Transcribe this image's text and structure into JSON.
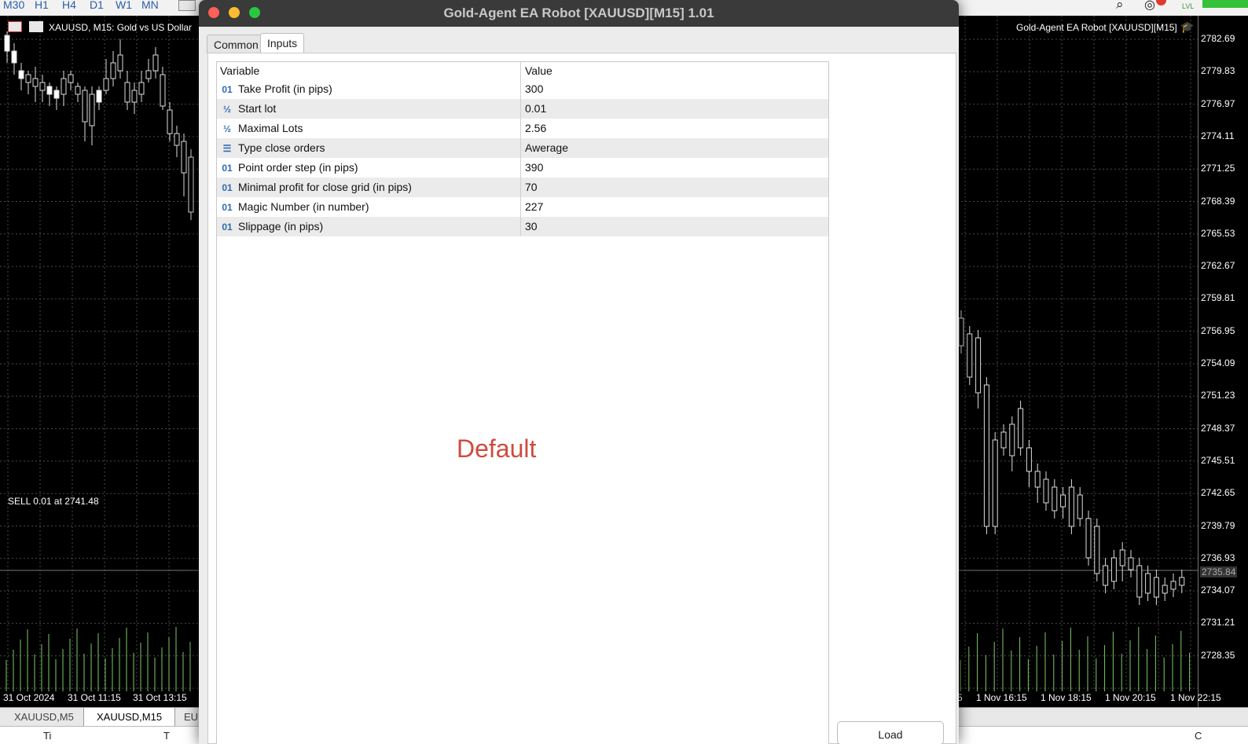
{
  "toolbar": {
    "timeframes": [
      "M30",
      "H1",
      "H4",
      "D1",
      "W1",
      "MN"
    ],
    "level_badge": "LVL"
  },
  "chart_left": {
    "title": "XAUUSD, M15:  Gold vs US Dollar",
    "trade_label": "SELL 0.01 at 2741.48",
    "time_labels": [
      "31 Oct 2024",
      "31 Oct 11:15",
      "31 Oct 13:15"
    ]
  },
  "chart_right": {
    "title": "Gold-Agent EA Robot [XAUUSD][M15]",
    "price_labels": [
      "2782.69",
      "2779.83",
      "2776.97",
      "2774.11",
      "2771.25",
      "2768.39",
      "2765.53",
      "2762.67",
      "2759.81",
      "2756.95",
      "2754.09",
      "2751.23",
      "2748.37",
      "2745.51",
      "2742.65",
      "2739.79",
      "2736.93",
      "2734.07",
      "2731.21",
      "2728.35"
    ],
    "current_price": "2735.84",
    "time_labels": [
      "5",
      "1 Nov 16:15",
      "1 Nov 18:15",
      "1 Nov 20:15",
      "1 Nov 22:15"
    ],
    "colors": {
      "up": "#ffffff",
      "down": "#e6f5e0",
      "volume": "#7ec86a",
      "grid": "#4a4a4a"
    }
  },
  "bottom_tabs": [
    "XAUUSD,M5",
    "XAUUSD,M15",
    "EUR"
  ],
  "bottom_strip": {
    "left": "Ti",
    "mid": "T",
    "right": "C"
  },
  "dialog": {
    "title": "Gold-Agent EA Robot [XAUUSD][M15] 1.01",
    "tabs": [
      "Common",
      "Inputs"
    ],
    "active_tab": "Inputs",
    "columns": {
      "variable": "Variable",
      "value": "Value"
    },
    "rows": [
      {
        "icon": "integer-icon",
        "glyph": "01",
        "variable": "Take Profit (in pips)",
        "value": "300"
      },
      {
        "icon": "fraction-icon",
        "glyph": "½",
        "variable": "Start lot",
        "value": "0.01"
      },
      {
        "icon": "fraction-icon",
        "glyph": "½",
        "variable": "Maximal Lots",
        "value": "2.56"
      },
      {
        "icon": "enum-icon",
        "glyph": "☰",
        "variable": "Type close orders",
        "value": "Awerage"
      },
      {
        "icon": "integer-icon",
        "glyph": "01",
        "variable": "Point order step (in pips)",
        "value": "390"
      },
      {
        "icon": "integer-icon",
        "glyph": "01",
        "variable": "Minimal profit for close grid (in pips)",
        "value": "70"
      },
      {
        "icon": "integer-icon",
        "glyph": "01",
        "variable": "Magic Number (in number)",
        "value": "227"
      },
      {
        "icon": "integer-icon",
        "glyph": "01",
        "variable": "Slippage (in pips)",
        "value": "30"
      }
    ],
    "watermark": "Default",
    "load_button": "Load",
    "colors": {
      "close": "#fe5f57",
      "minimize": "#febc2e",
      "zoom": "#28c840",
      "watermark": "#cf4b3e"
    }
  }
}
